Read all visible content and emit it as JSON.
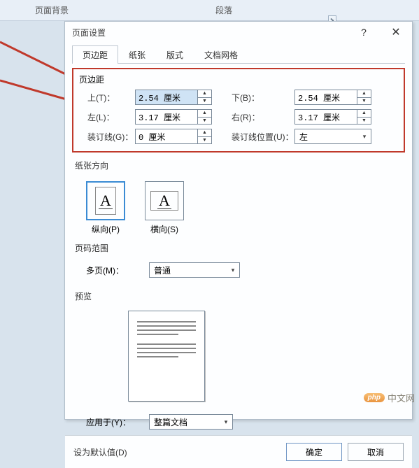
{
  "ribbon": {
    "tab1": "页面背景",
    "tab2": "段落"
  },
  "dialog": {
    "title": "页面设置",
    "tabs": {
      "margins": "页边距",
      "paper": "纸张",
      "layout": "版式",
      "grid": "文档网格"
    },
    "margins": {
      "title": "页边距",
      "top_label": "上(T)：",
      "top_value": "2.54 厘米",
      "bottom_label": "下(B)：",
      "bottom_value": "2.54 厘米",
      "left_label": "左(L)：",
      "left_value": "3.17 厘米",
      "right_label": "右(R)：",
      "right_value": "3.17 厘米",
      "gutter_label": "装订线(G)：",
      "gutter_value": "0 厘米",
      "gutter_pos_label": "装订线位置(U)：",
      "gutter_pos_value": "左"
    },
    "orientation": {
      "title": "纸张方向",
      "portrait": "纵向(P)",
      "landscape": "横向(S)"
    },
    "pages": {
      "title": "页码范围",
      "multi_label": "多页(M)：",
      "multi_value": "普通"
    },
    "preview": {
      "title": "预览"
    },
    "apply": {
      "label": "应用于(Y)：",
      "value": "整篇文档"
    },
    "footer": {
      "default": "设为默认值(D)",
      "ok": "确定",
      "cancel": "取消"
    }
  },
  "watermark": {
    "badge": "php",
    "text": "中文网"
  }
}
